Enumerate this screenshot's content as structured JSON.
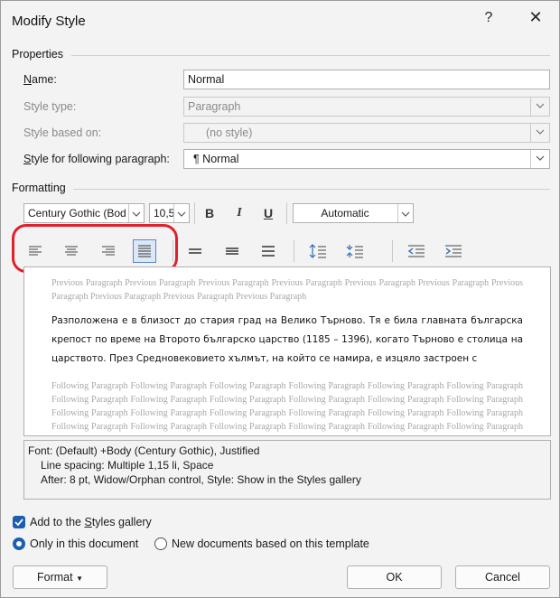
{
  "dialog": {
    "title": "Modify Style",
    "help": "?",
    "close": "✕"
  },
  "properties": {
    "heading": "Properties",
    "name_label": "Name:",
    "name_value": "Normal",
    "style_type_label": "Style type:",
    "style_type_value": "Paragraph",
    "based_on_label": "Style based on:",
    "based_on_value": "(no style)",
    "following_label": "Style for following paragraph:",
    "following_value": "¶ Normal"
  },
  "formatting": {
    "heading": "Formatting",
    "font": "Century Gothic (Bod",
    "size": "10,5",
    "bold": "B",
    "italic": "I",
    "underline": "U",
    "color": "Automatic",
    "selected_alignment": "justify"
  },
  "preview": {
    "previous_text": "Previous Paragraph Previous Paragraph Previous Paragraph Previous Paragraph Previous Paragraph Previous Paragraph Previous Paragraph Previous Paragraph Previous Paragraph Previous Paragraph",
    "sample_text": "Разположена е в близост до стария град на Велико Търново. Тя е била главната българска крепост по време на Второто българско царство (1185 – 1396), когато Търново е столица на царството. През Средновековието хълмът, на който се намира, е изцяло застроен с",
    "following_text": "Following Paragraph Following Paragraph Following Paragraph Following Paragraph Following Paragraph Following Paragraph Following Paragraph Following Paragraph Following Paragraph Following Paragraph Following Paragraph Following Paragraph Following Paragraph Following Paragraph Following Paragraph Following Paragraph Following Paragraph Following Paragraph Following Paragraph Following Paragraph Following Paragraph Following Paragraph Following Paragraph Following Paragraph Following Paragraph Following Paragraph Following Paragraph Following Paragraph Following Paragraph Following Paragraph Following Paragraph Following Paragraph Following Paragraph Following Paragraph Following Paragraph"
  },
  "description": {
    "line1": "Font: (Default) +Body (Century Gothic), Justified",
    "line2": "Line spacing:  Multiple 1,15 li, Space",
    "line3": "After:  8 pt, Widow/Orphan control, Style: Show in the Styles gallery"
  },
  "options": {
    "add_gallery": "Add to the Styles gallery",
    "add_gallery_checked": true,
    "only_doc": "Only in this document",
    "new_docs": "New documents based on this template"
  },
  "buttons": {
    "format": "Format",
    "ok": "OK",
    "cancel": "Cancel"
  },
  "colors": {
    "accent": "#1c5fb0",
    "highlight": "#e0202a"
  }
}
